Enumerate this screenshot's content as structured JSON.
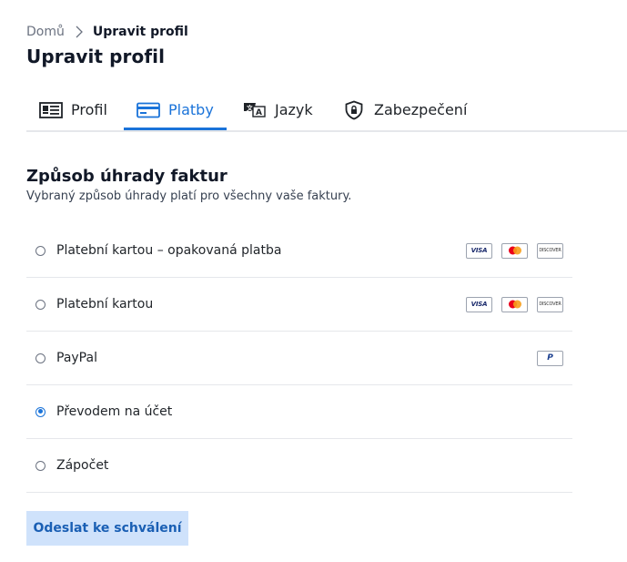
{
  "breadcrumb": {
    "home": "Domů",
    "current": "Upravit profil"
  },
  "page_title": "Upravit profil",
  "tabs": [
    {
      "label": "Profil",
      "icon": "id-card-icon",
      "active": false
    },
    {
      "label": "Platby",
      "icon": "credit-card-icon",
      "active": true
    },
    {
      "label": "Jazyk",
      "icon": "translate-icon",
      "active": false
    },
    {
      "label": "Zabezpečení",
      "icon": "shield-lock-icon",
      "active": false
    }
  ],
  "section": {
    "title": "Způsob úhrady faktur",
    "subtitle": "Vybraný způsob úhrady platí pro všechny vaše faktury."
  },
  "payment_options": [
    {
      "label": "Platební kartou – opakovaná platba",
      "selected": false,
      "logos": [
        "VISA",
        "mastercard",
        "DISCOVER"
      ]
    },
    {
      "label": "Platební kartou",
      "selected": false,
      "logos": [
        "VISA",
        "mastercard",
        "DISCOVER"
      ]
    },
    {
      "label": "PayPal",
      "selected": false,
      "logos": [
        "P"
      ]
    },
    {
      "label": "Převodem na účet",
      "selected": true,
      "logos": []
    },
    {
      "label": "Zápočet",
      "selected": false,
      "logos": []
    }
  ],
  "submit_label": "Odeslat ke schválení",
  "colors": {
    "accent": "#1a73d9",
    "button_bg": "#cfe2fb",
    "button_text": "#1a5fb4",
    "divider": "#e5e7eb"
  }
}
